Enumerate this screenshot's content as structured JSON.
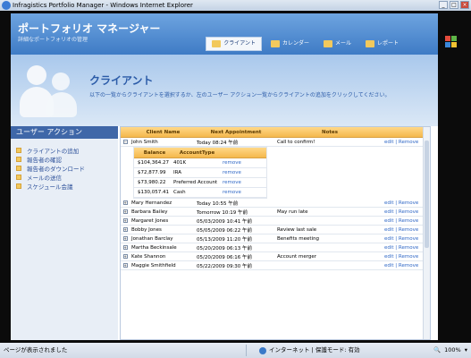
{
  "browser": {
    "title": "Infragistics Portfolio Manager - Windows Internet Explorer",
    "status_text": "ページが表示されました",
    "zone_text": "インターネット | 保護モード: 有効",
    "zoom_text": "100%"
  },
  "header": {
    "title": "ポートフォリオ マネージャー",
    "subtitle": "詳細なポートフォリオの管理",
    "tabs": [
      {
        "label": "クライアント",
        "active": true
      },
      {
        "label": "カレンダー"
      },
      {
        "label": "メール"
      },
      {
        "label": "レポート"
      }
    ]
  },
  "banner": {
    "title": "クライアント",
    "description": "以下の一覧からクライアントを選択するか、左のユーザー アクション一覧からクライアントの追加をクリックしてください。"
  },
  "sidebar": {
    "header": "ユーザー アクション",
    "items": [
      "クライアントの追加",
      "報告者の確認",
      "報告者のダウンロード",
      "メールの送信",
      "スケジュール会議"
    ]
  },
  "grid": {
    "columns": [
      "Client Name",
      "Next Appointment",
      "Notes"
    ],
    "expanded": {
      "client": "John Smith",
      "appointment": "Today 08:24 午前",
      "notes": "Call to confirm!",
      "actions": "edit | Remove",
      "sub_columns": [
        "Balance",
        "AccountType"
      ],
      "sub_rows": [
        {
          "balance": "$104,364.27",
          "type": "401K",
          "action": "remove"
        },
        {
          "balance": "$72,877.99",
          "type": "IRA",
          "action": "remove"
        },
        {
          "balance": "$73,980.22",
          "type": "Preferred Account",
          "action": "remove"
        },
        {
          "balance": "$130,057.41",
          "type": "Cash",
          "action": "remove"
        }
      ]
    },
    "rows": [
      {
        "client": "Mary Hernandez",
        "appointment": "Today 10:55 午前",
        "notes": "",
        "actions": "edit | Remove"
      },
      {
        "client": "Barbara Bailey",
        "appointment": "Tomorrow 10:19 午前",
        "notes": "May run late",
        "actions": "edit | Remove"
      },
      {
        "client": "Margaret Jones",
        "appointment": "05/03/2009 10:41 午前",
        "notes": "",
        "actions": "edit | Remove"
      },
      {
        "client": "Bobby Jones",
        "appointment": "05/05/2009 06:22 午前",
        "notes": "Review last sale",
        "actions": "edit | Remove"
      },
      {
        "client": "Jonathan Barclay",
        "appointment": "05/13/2009 11:20 午前",
        "notes": "Benefits meeting",
        "actions": "edit | Remove"
      },
      {
        "client": "Martha Beckinsale",
        "appointment": "05/20/2009 06:13 午前",
        "notes": "",
        "actions": "edit | Remove"
      },
      {
        "client": "Kate Shannon",
        "appointment": "05/20/2009 06:16 午前",
        "notes": "Account merger",
        "actions": "edit | Remove"
      },
      {
        "client": "Maggie Smithfield",
        "appointment": "05/22/2009 09:30 午前",
        "notes": "",
        "actions": "edit | Remove"
      }
    ]
  }
}
